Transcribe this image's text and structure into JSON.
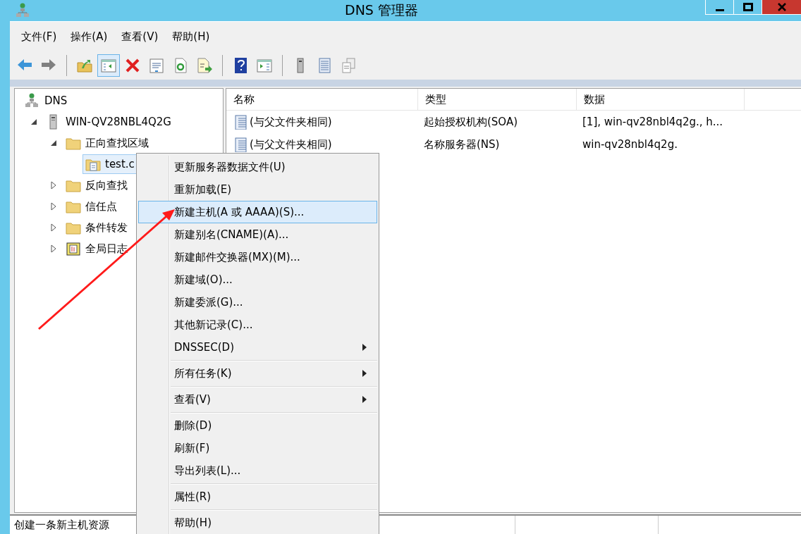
{
  "window": {
    "title": "DNS 管理器"
  },
  "menu": [
    "文件(F)",
    "操作(A)",
    "查看(V)",
    "帮助(H)"
  ],
  "toolbar": [
    {
      "kind": "back",
      "selected": false
    },
    {
      "kind": "forward",
      "selected": false
    },
    {
      "kind": "separator"
    },
    {
      "kind": "up",
      "selected": false
    },
    {
      "kind": "console-tree",
      "selected": true
    },
    {
      "kind": "delete",
      "selected": false
    },
    {
      "kind": "properties",
      "selected": false
    },
    {
      "kind": "refresh",
      "selected": false
    },
    {
      "kind": "export",
      "selected": false
    },
    {
      "kind": "separator"
    },
    {
      "kind": "help",
      "selected": false
    },
    {
      "kind": "action-pane",
      "selected": false
    },
    {
      "kind": "separator"
    },
    {
      "kind": "server",
      "selected": false
    },
    {
      "kind": "list",
      "selected": false
    },
    {
      "kind": "copy",
      "selected": false
    }
  ],
  "tree": [
    {
      "label": "DNS",
      "kind": "dns",
      "selected": false,
      "children": [
        {
          "label": "WIN-QV28NBL4Q2G",
          "kind": "server",
          "expanded": true,
          "selected": false,
          "children": [
            {
              "label": "正向查找区域",
              "kind": "folder",
              "expanded": true,
              "selected": false,
              "children": [
                {
                  "label": "test.c",
                  "kind": "zone",
                  "selected": true
                }
              ]
            },
            {
              "label": "反向查找",
              "kind": "folder",
              "expanded": false,
              "selected": false
            },
            {
              "label": "信任点",
              "kind": "folder",
              "expanded": false,
              "selected": false
            },
            {
              "label": "条件转发",
              "kind": "folder",
              "expanded": false,
              "selected": false
            },
            {
              "label": "全局日志",
              "kind": "log",
              "expanded": false,
              "selected": false
            }
          ]
        }
      ]
    }
  ],
  "list": {
    "columns": [
      "名称",
      "类型",
      "数据"
    ],
    "rows": [
      {
        "cells": [
          "(与父文件夹相同)",
          "起始授权机构(SOA)",
          "[1], win-qv28nbl4q2g., h..."
        ]
      },
      {
        "cells": [
          "(与父文件夹相同)",
          "名称服务器(NS)",
          "win-qv28nbl4q2g."
        ]
      }
    ]
  },
  "context_menu": {
    "items": [
      {
        "kind": "item",
        "label": "更新服务器数据文件(U)",
        "selected": false,
        "submenu": false
      },
      {
        "kind": "item",
        "label": "重新加载(E)",
        "selected": false,
        "submenu": false
      },
      {
        "kind": "item",
        "label": "新建主机(A 或 AAAA)(S)...",
        "selected": true,
        "submenu": false
      },
      {
        "kind": "item",
        "label": "新建别名(CNAME)(A)...",
        "selected": false,
        "submenu": false
      },
      {
        "kind": "item",
        "label": "新建邮件交换器(MX)(M)...",
        "selected": false,
        "submenu": false
      },
      {
        "kind": "item",
        "label": "新建域(O)...",
        "selected": false,
        "submenu": false
      },
      {
        "kind": "item",
        "label": "新建委派(G)...",
        "selected": false,
        "submenu": false
      },
      {
        "kind": "item",
        "label": "其他新记录(C)...",
        "selected": false,
        "submenu": false
      },
      {
        "kind": "item",
        "label": "DNSSEC(D)",
        "selected": false,
        "submenu": true
      },
      {
        "kind": "separator"
      },
      {
        "kind": "item",
        "label": "所有任务(K)",
        "selected": false,
        "submenu": true
      },
      {
        "kind": "separator"
      },
      {
        "kind": "item",
        "label": "查看(V)",
        "selected": false,
        "submenu": true
      },
      {
        "kind": "separator"
      },
      {
        "kind": "item",
        "label": "删除(D)",
        "selected": false,
        "submenu": false
      },
      {
        "kind": "item",
        "label": "刷新(F)",
        "selected": false,
        "submenu": false
      },
      {
        "kind": "item",
        "label": "导出列表(L)...",
        "selected": false,
        "submenu": false
      },
      {
        "kind": "separator"
      },
      {
        "kind": "item",
        "label": "属性(R)",
        "selected": false,
        "submenu": false
      },
      {
        "kind": "separator"
      },
      {
        "kind": "item",
        "label": "帮助(H)",
        "selected": false,
        "submenu": false
      }
    ]
  },
  "status_bar": {
    "text": "创建一条新主机资源"
  },
  "annotation": {
    "kind": "arrow"
  }
}
